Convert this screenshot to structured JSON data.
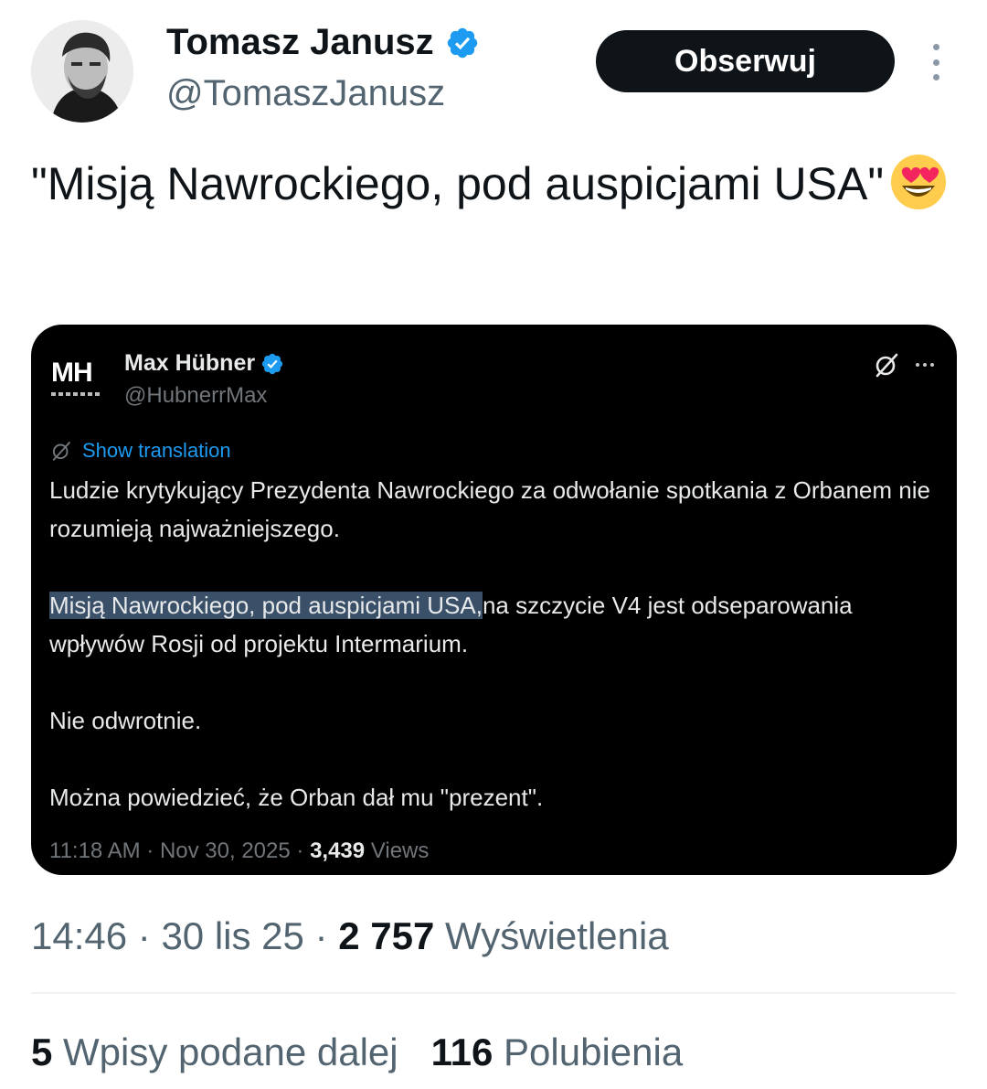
{
  "author": {
    "name": "Tomasz Janusz",
    "handle": "@TomaszJanusz"
  },
  "follow_label": "Obserwuj",
  "tweet": {
    "text": "\"Misją Nawrockiego, pod auspicjami USA\"",
    "emoji": "smiling-face-with-heart-eyes"
  },
  "quote": {
    "logo_text": "MH",
    "name": "Max Hübner",
    "handle": "@HubnerrMax",
    "translate_label": "Show translation",
    "paragraph1": "Ludzie krytykujący Prezydenta Nawrockiego za odwołanie spotkania z Orbanem nie rozumieją najważniejszego.",
    "paragraph2_highlight": "Misją Nawrockiego, pod auspicjami USA,",
    "paragraph2_rest": "na szczycie V4 jest odseparowania wpływów Rosji od projektu Intermarium.",
    "paragraph3": "Nie odwrotnie.",
    "paragraph4": "Można powiedzieć, że Orban dał mu \"prezent\".",
    "time": "11:18 AM",
    "date": "Nov 30, 2025",
    "views_count": "3,439",
    "views_label": "Views"
  },
  "meta": {
    "time": "14:46",
    "date": "30 lis 25",
    "views_count": "2 757",
    "views_label": "Wyświetlenia"
  },
  "stats": {
    "reposts_count": "5",
    "reposts_label": "Wpisy podane dalej",
    "likes_count": "116",
    "likes_label": "Polubienia"
  },
  "colors": {
    "verified": "#1d9bf0",
    "follow_bg": "#0f1419",
    "quote_bg": "#000000",
    "highlight": "#3a5068"
  }
}
